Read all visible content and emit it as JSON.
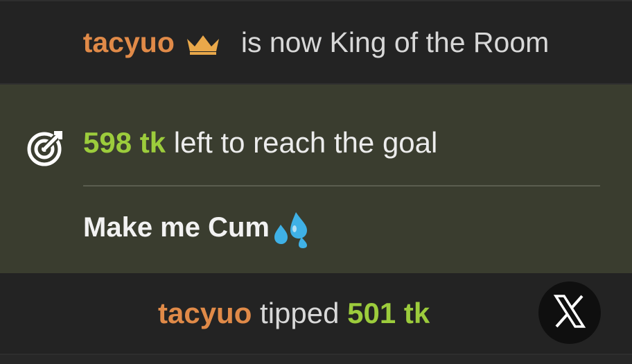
{
  "king_notice": {
    "username": "tacyuo",
    "icon": "crown-icon",
    "message": "is now King of the Room"
  },
  "goal": {
    "icon": "target-goal-icon",
    "amount": "598 tk",
    "message": "left to reach the goal",
    "title": "Make me Cum",
    "title_icon": "sweat-droplets-icon"
  },
  "tip_notice": {
    "username": "tacyuo",
    "action": "tipped",
    "amount": "501 tk",
    "close_icon": "close-x-icon"
  },
  "colors": {
    "username": "#e08a48",
    "amount": "#9ccc3c",
    "goal_panel_bg": "#3a3d2f",
    "bar_bg": "#232323",
    "crown": "#e9a84a",
    "droplets": "#3fb1e6"
  }
}
